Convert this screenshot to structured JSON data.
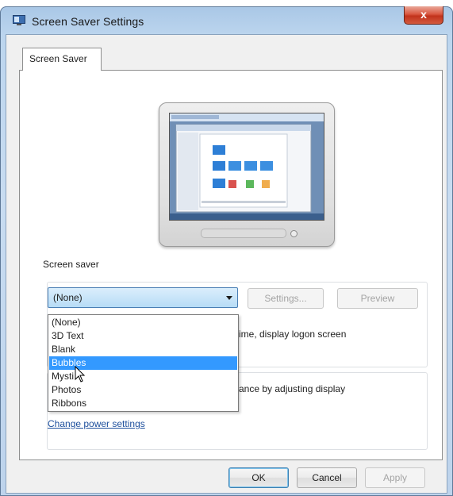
{
  "window": {
    "title": "Screen Saver Settings",
    "close_glyph": "x"
  },
  "tabs": [
    {
      "label": "Screen Saver",
      "selected": true
    }
  ],
  "screensaver_group": {
    "label": "Screen saver",
    "selected_value": "(None)",
    "options": [
      "(None)",
      "3D Text",
      "Blank",
      "Bubbles",
      "Mystify",
      "Photos",
      "Ribbons"
    ],
    "highlighted_option": "Bubbles",
    "visible_texts": {
      "logon_partial": "ime, display logon screen",
      "display_partial": "ance by adjusting display",
      "mystify_partial": "Mysti"
    },
    "settings_button": "Settings...",
    "preview_button": "Preview"
  },
  "power_link": "Change power settings",
  "footer": {
    "ok": "OK",
    "cancel": "Cancel",
    "apply": "Apply"
  },
  "colors": {
    "selection": "#3399ff",
    "link": "#1c4e9c",
    "close": "#c1331c"
  }
}
